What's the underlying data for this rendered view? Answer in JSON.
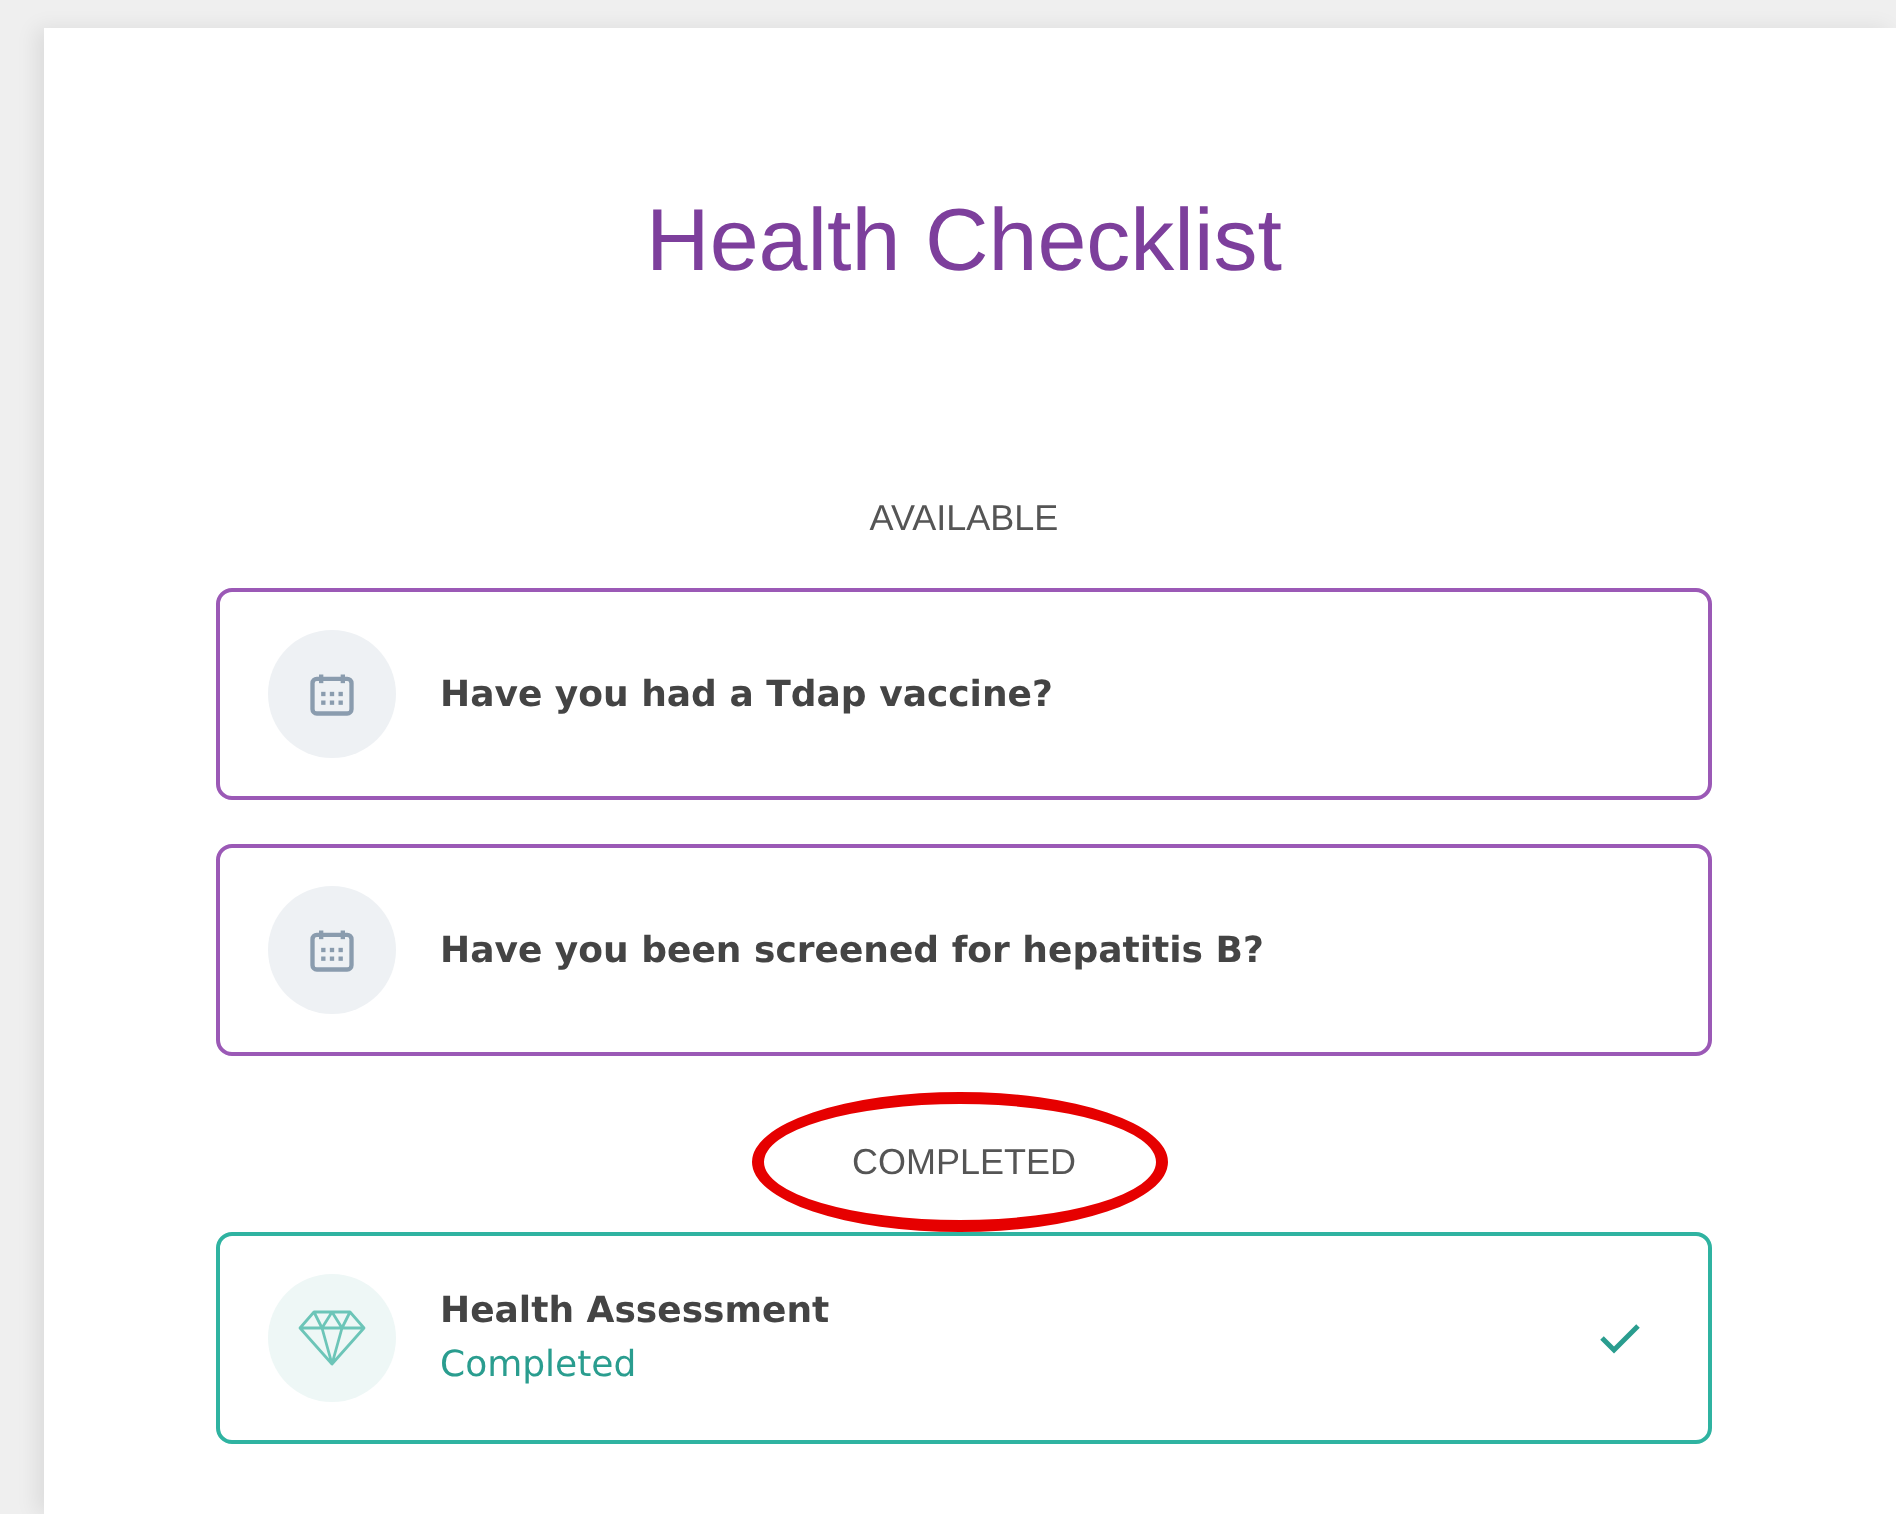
{
  "title": "Health Checklist",
  "sections": [
    {
      "heading": "AVAILABLE",
      "circled": false,
      "items": [
        {
          "kind": "question",
          "title": "Have you had a Tdap vaccine?",
          "completed": false
        },
        {
          "kind": "question",
          "title": "Have you been screened for hepatitis B?",
          "completed": false
        }
      ]
    },
    {
      "heading": "COMPLETED",
      "circled": true,
      "items": [
        {
          "kind": "assessment",
          "title": "Health Assessment",
          "status": "Completed",
          "completed": true
        }
      ]
    }
  ]
}
